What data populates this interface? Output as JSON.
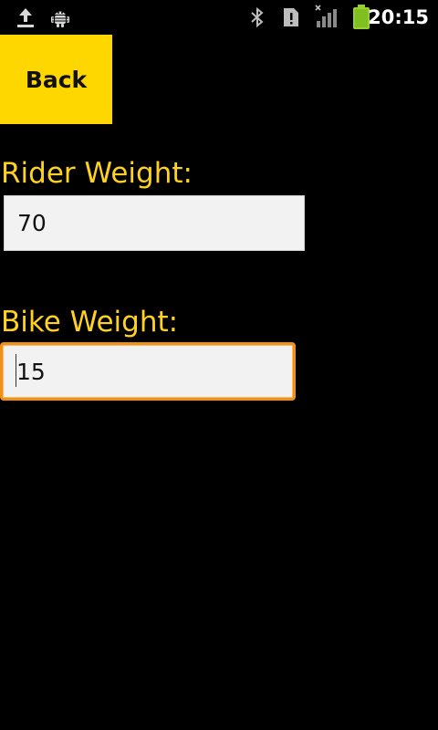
{
  "status_bar": {
    "time": "20:15",
    "icons": [
      "upload-icon",
      "android-debug-icon",
      "bluetooth-icon",
      "sim-card-alert-icon",
      "signal-no-data-icon",
      "battery-charging-icon"
    ]
  },
  "back_button": {
    "label": "Back"
  },
  "rider_weight": {
    "label": "Rider Weight:",
    "value": "70"
  },
  "bike_weight": {
    "label": "Bike Weight:",
    "value": "15"
  },
  "colors": {
    "background": "#000000",
    "accent_yellow": "#FFD700",
    "label_yellow": "#FFD21F",
    "focus_orange": "#F0901C",
    "field_bg": "#F2F2F2"
  }
}
